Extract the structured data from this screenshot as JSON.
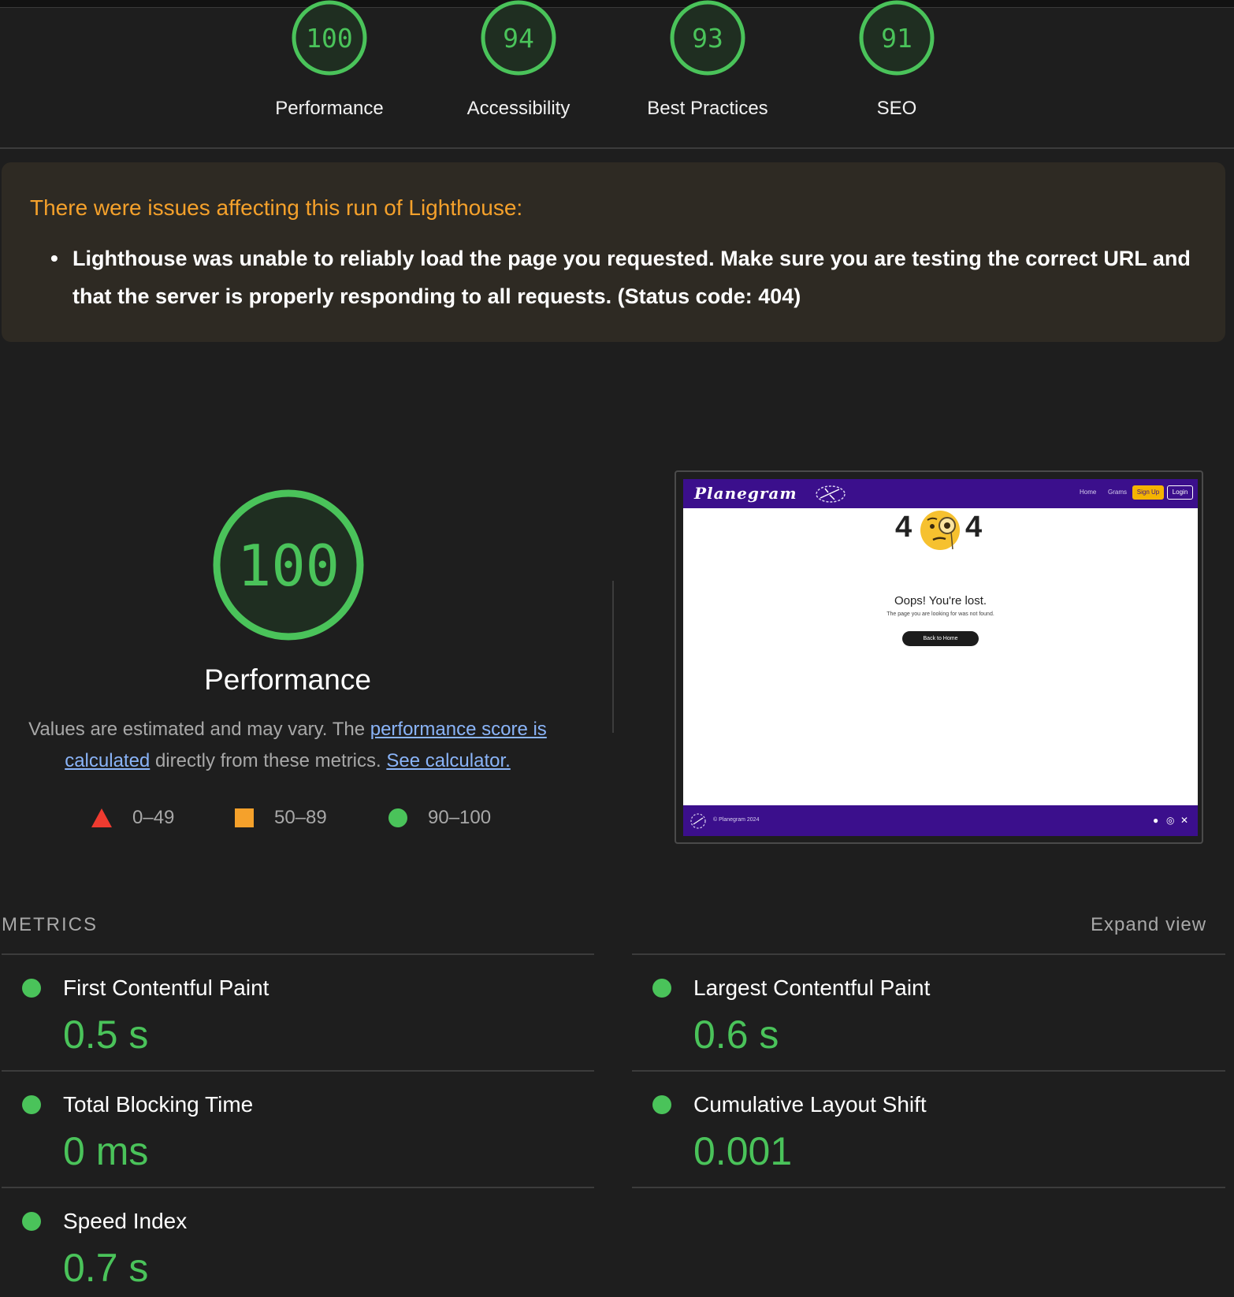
{
  "gauges": [
    {
      "score": "100",
      "label": "Performance"
    },
    {
      "score": "94",
      "label": "Accessibility"
    },
    {
      "score": "93",
      "label": "Best Practices"
    },
    {
      "score": "91",
      "label": "SEO"
    }
  ],
  "warning": {
    "title": "There were issues affecting this run of Lighthouse:",
    "items": [
      "Lighthouse was unable to reliably load the page you requested. Make sure you are testing the correct URL and that the server is properly responding to all requests. (Status code: 404)"
    ]
  },
  "performance": {
    "score": "100",
    "title": "Performance",
    "desc_part1": "Values are estimated and may vary. The ",
    "desc_link1": "performance score is calculated",
    "desc_part2": " directly from these metrics. ",
    "desc_link2": "See calculator.",
    "legend": [
      {
        "shape": "triangle",
        "range": "0–49"
      },
      {
        "shape": "square",
        "range": "50–89"
      },
      {
        "shape": "circle",
        "range": "90–100"
      }
    ]
  },
  "screenshot": {
    "logo": "Planegram",
    "nav": [
      "Home",
      "Grams"
    ],
    "signup": "Sign Up",
    "login": "Login",
    "four_left": "4",
    "four_right": "4",
    "heading": "Oops! You're lost.",
    "sub": "The page you are looking for was not found.",
    "button": "Back to Home",
    "footer": "© Planegram 2024",
    "social_icons": [
      "facebook-icon",
      "instagram-icon",
      "x-icon"
    ]
  },
  "metrics": {
    "header": "METRICS",
    "expand": "Expand view",
    "items": [
      {
        "name": "First Contentful Paint",
        "value": "0.5 s"
      },
      {
        "name": "Largest Contentful Paint",
        "value": "0.6 s"
      },
      {
        "name": "Total Blocking Time",
        "value": "0 ms"
      },
      {
        "name": "Cumulative Layout Shift",
        "value": "0.001"
      },
      {
        "name": "Speed Index",
        "value": "0.7 s"
      }
    ]
  },
  "colors": {
    "pass": "#4ac35a",
    "average": "#f5a12b",
    "fail": "#ef3b30",
    "link": "#8ab4f8"
  }
}
